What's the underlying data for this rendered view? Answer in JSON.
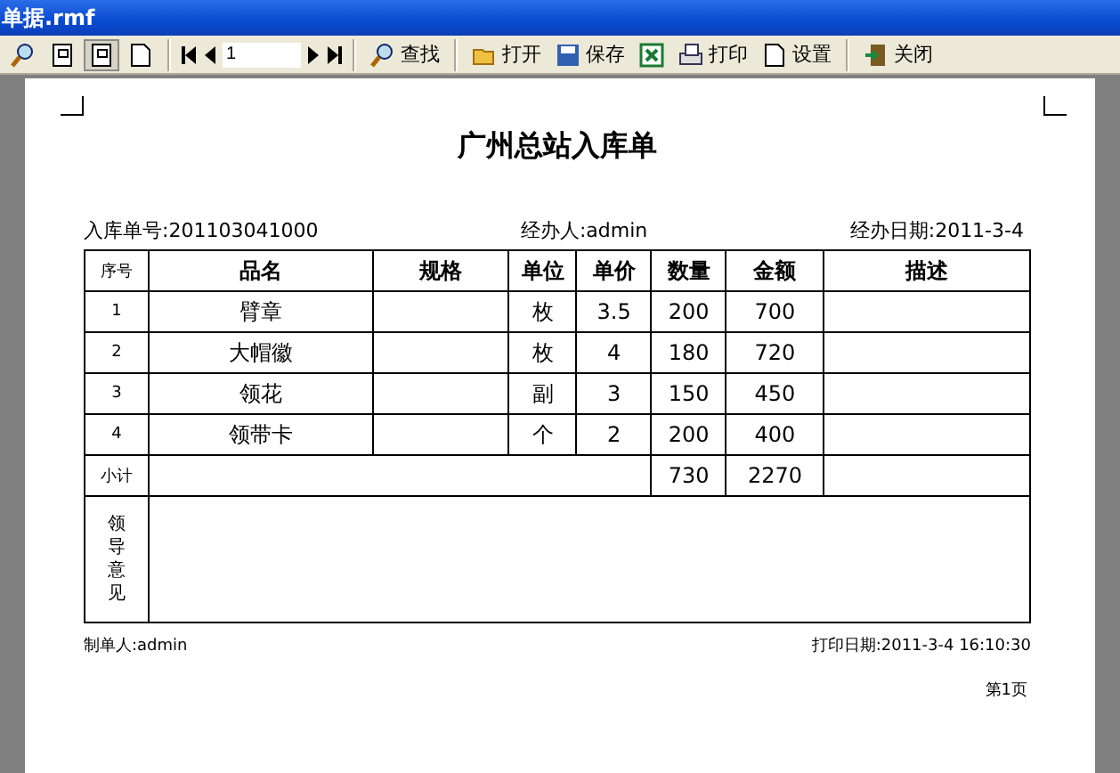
{
  "window": {
    "title": "单据.rmf"
  },
  "toolbar": {
    "view_buttons": [
      {
        "kind": "zoom",
        "selected": false
      },
      {
        "kind": "page",
        "selected": false
      },
      {
        "kind": "page",
        "selected": true
      },
      {
        "kind": "blank",
        "selected": false
      }
    ],
    "page_field": {
      "value": "1"
    },
    "actions": [
      {
        "kind": "find",
        "label": "查找"
      },
      {
        "kind": "open",
        "label": "打开"
      },
      {
        "kind": "save",
        "label": "保存"
      },
      {
        "kind": "excel"
      },
      {
        "kind": "print",
        "label": "打印"
      },
      {
        "kind": "setup",
        "label": "设置"
      },
      {
        "kind": "close",
        "label": "关闭"
      }
    ]
  },
  "report": {
    "title": "广州总站入库单",
    "header_fields": [
      "入库单号:201103041000",
      "经办人:admin",
      "经办日期:2011-3-4"
    ],
    "table": {
      "columns": [
        "序号",
        "品名",
        "规格",
        "单位",
        "单价",
        "数量",
        "金额",
        "描述"
      ],
      "rows": [
        [
          "1",
          "臂章",
          "",
          "枚",
          "3.5",
          "200",
          "700",
          ""
        ],
        [
          "2",
          "大帽徽",
          "",
          "枚",
          "4",
          "180",
          "720",
          ""
        ],
        [
          "3",
          "领花",
          "",
          "副",
          "3",
          "150",
          "450",
          ""
        ],
        [
          "4",
          "领带卡",
          "",
          "个",
          "2",
          "200",
          "400",
          ""
        ]
      ],
      "subtotal": {
        "label": "小计",
        "quantity": "730",
        "amount": "2270"
      },
      "remarks": {
        "label": "领导意见"
      }
    },
    "footer_left": "制单人:admin",
    "footer_right": "打印日期:2011-3-4 16:10:30",
    "page_number": "第1页"
  }
}
